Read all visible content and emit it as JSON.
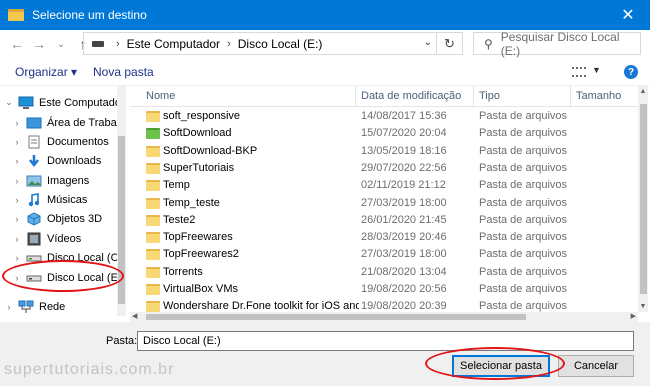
{
  "window": {
    "title": "Selecione um destino",
    "close_glyph": "✕"
  },
  "address": {
    "crumbs": [
      "Este Computador",
      "Disco Local (E:)"
    ],
    "separator": "›",
    "search_placeholder": "Pesquisar Disco Local (E:)"
  },
  "toolbar": {
    "organize": "Organizar ▾",
    "new_folder": "Nova pasta",
    "help": "?"
  },
  "sidebar": {
    "items": [
      {
        "label": "Este Computador",
        "icon": "computer-icon",
        "chevron": "⌄"
      },
      {
        "label": "Área de Trabalho",
        "icon": "desktop-icon",
        "chevron": "›"
      },
      {
        "label": "Documentos",
        "icon": "documents-icon",
        "chevron": "›"
      },
      {
        "label": "Downloads",
        "icon": "downloads-icon",
        "chevron": "›"
      },
      {
        "label": "Imagens",
        "icon": "pictures-icon",
        "chevron": "›"
      },
      {
        "label": "Músicas",
        "icon": "music-icon",
        "chevron": "›"
      },
      {
        "label": "Objetos 3D",
        "icon": "3d-objects-icon",
        "chevron": "›"
      },
      {
        "label": "Vídeos",
        "icon": "videos-icon",
        "chevron": "›"
      },
      {
        "label": "Disco Local (C:)",
        "icon": "drive-icon",
        "chevron": "›"
      },
      {
        "label": "Disco Local (E:)",
        "icon": "drive-icon",
        "chevron": "›"
      },
      {
        "label": "Rede",
        "icon": "network-icon",
        "chevron": "›"
      }
    ]
  },
  "columns": {
    "name": "Nome",
    "date": "Data de modificação",
    "type": "Tipo",
    "size": "Tamanho"
  },
  "files": [
    {
      "name": "soft_responsive",
      "date": "14/08/2017 15:36",
      "type": "Pasta de arquivos",
      "color": "yellow"
    },
    {
      "name": "SoftDownload",
      "date": "15/07/2020 20:04",
      "type": "Pasta de arquivos",
      "color": "green"
    },
    {
      "name": "SoftDownload-BKP",
      "date": "13/05/2019 18:16",
      "type": "Pasta de arquivos",
      "color": "yellow"
    },
    {
      "name": "SuperTutoriais",
      "date": "29/07/2020 22:56",
      "type": "Pasta de arquivos",
      "color": "yellow"
    },
    {
      "name": "Temp",
      "date": "02/11/2019 21:12",
      "type": "Pasta de arquivos",
      "color": "yellow"
    },
    {
      "name": "Temp_teste",
      "date": "27/03/2019 18:00",
      "type": "Pasta de arquivos",
      "color": "yellow"
    },
    {
      "name": "Teste2",
      "date": "26/01/2020 21:45",
      "type": "Pasta de arquivos",
      "color": "yellow"
    },
    {
      "name": "TopFreewares",
      "date": "28/03/2019 20:46",
      "type": "Pasta de arquivos",
      "color": "yellow"
    },
    {
      "name": "TopFreewares2",
      "date": "27/03/2019 18:00",
      "type": "Pasta de arquivos",
      "color": "yellow"
    },
    {
      "name": "Torrents",
      "date": "21/08/2020 13:04",
      "type": "Pasta de arquivos",
      "color": "yellow"
    },
    {
      "name": "VirtualBox VMs",
      "date": "19/08/2020 20:56",
      "type": "Pasta de arquivos",
      "color": "yellow"
    },
    {
      "name": "Wondershare Dr.Fone toolkit for iOS and ...",
      "date": "19/08/2020 20:39",
      "type": "Pasta de arquivos",
      "color": "yellow"
    }
  ],
  "footer": {
    "folder_label": "Pasta:",
    "folder_value": "Disco Local (E:)",
    "select_button": "Selecionar pasta",
    "cancel_button": "Cancelar",
    "watermark": "supertutoriais.com.br"
  },
  "colors": {
    "accent": "#0078d7",
    "highlight": "#e01515",
    "folder": "#f8d775",
    "folder_green": "#6cc24a"
  }
}
